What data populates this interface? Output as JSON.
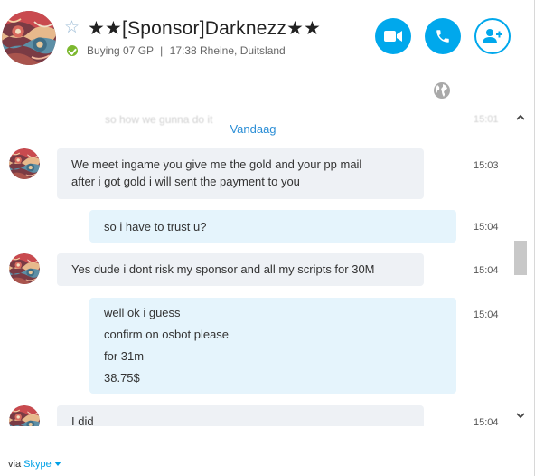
{
  "header": {
    "contact_name": "★★[Sponsor]Darknezz★★",
    "mood_status": "Buying 07 GP",
    "separator": "|",
    "local_time_location": "17:38 Rheine, Duitsland",
    "star_glyph": "☆",
    "buttons": {
      "video_call": "video-camera-icon",
      "audio_call": "phone-icon",
      "add_people": "add-person-icon"
    },
    "status": "online"
  },
  "chat": {
    "faded_previous_message": "so how we gunna do it",
    "faded_previous_time": "15:01",
    "day_separator": "Vandaag",
    "messages": [
      {
        "direction": "incoming",
        "lines": [
          "We meet ingame you give me the gold and your pp mail",
          "after i got gold i will sent the payment to you"
        ],
        "time": "15:03"
      },
      {
        "direction": "outgoing",
        "lines": [
          "so i have to trust u?"
        ],
        "time": "15:04"
      },
      {
        "direction": "incoming",
        "lines": [
          "Yes dude i dont risk my sponsor and all my scripts for 30M"
        ],
        "time": "15:04"
      },
      {
        "direction": "outgoing",
        "lines": [
          "well ok i guess",
          "confirm on osbot please",
          "for 31m",
          "38.75$"
        ],
        "time": "15:04"
      },
      {
        "direction": "incoming",
        "lines": [
          "I did"
        ],
        "time": "15:04"
      }
    ]
  },
  "footer": {
    "via_label": "via",
    "service_name": "Skype"
  },
  "colors": {
    "accent": "#00a8ec",
    "link": "#2b8ed6",
    "incoming_bubble": "#eef1f5",
    "outgoing_bubble": "#e5f4fc",
    "online": "#7cb82f"
  }
}
